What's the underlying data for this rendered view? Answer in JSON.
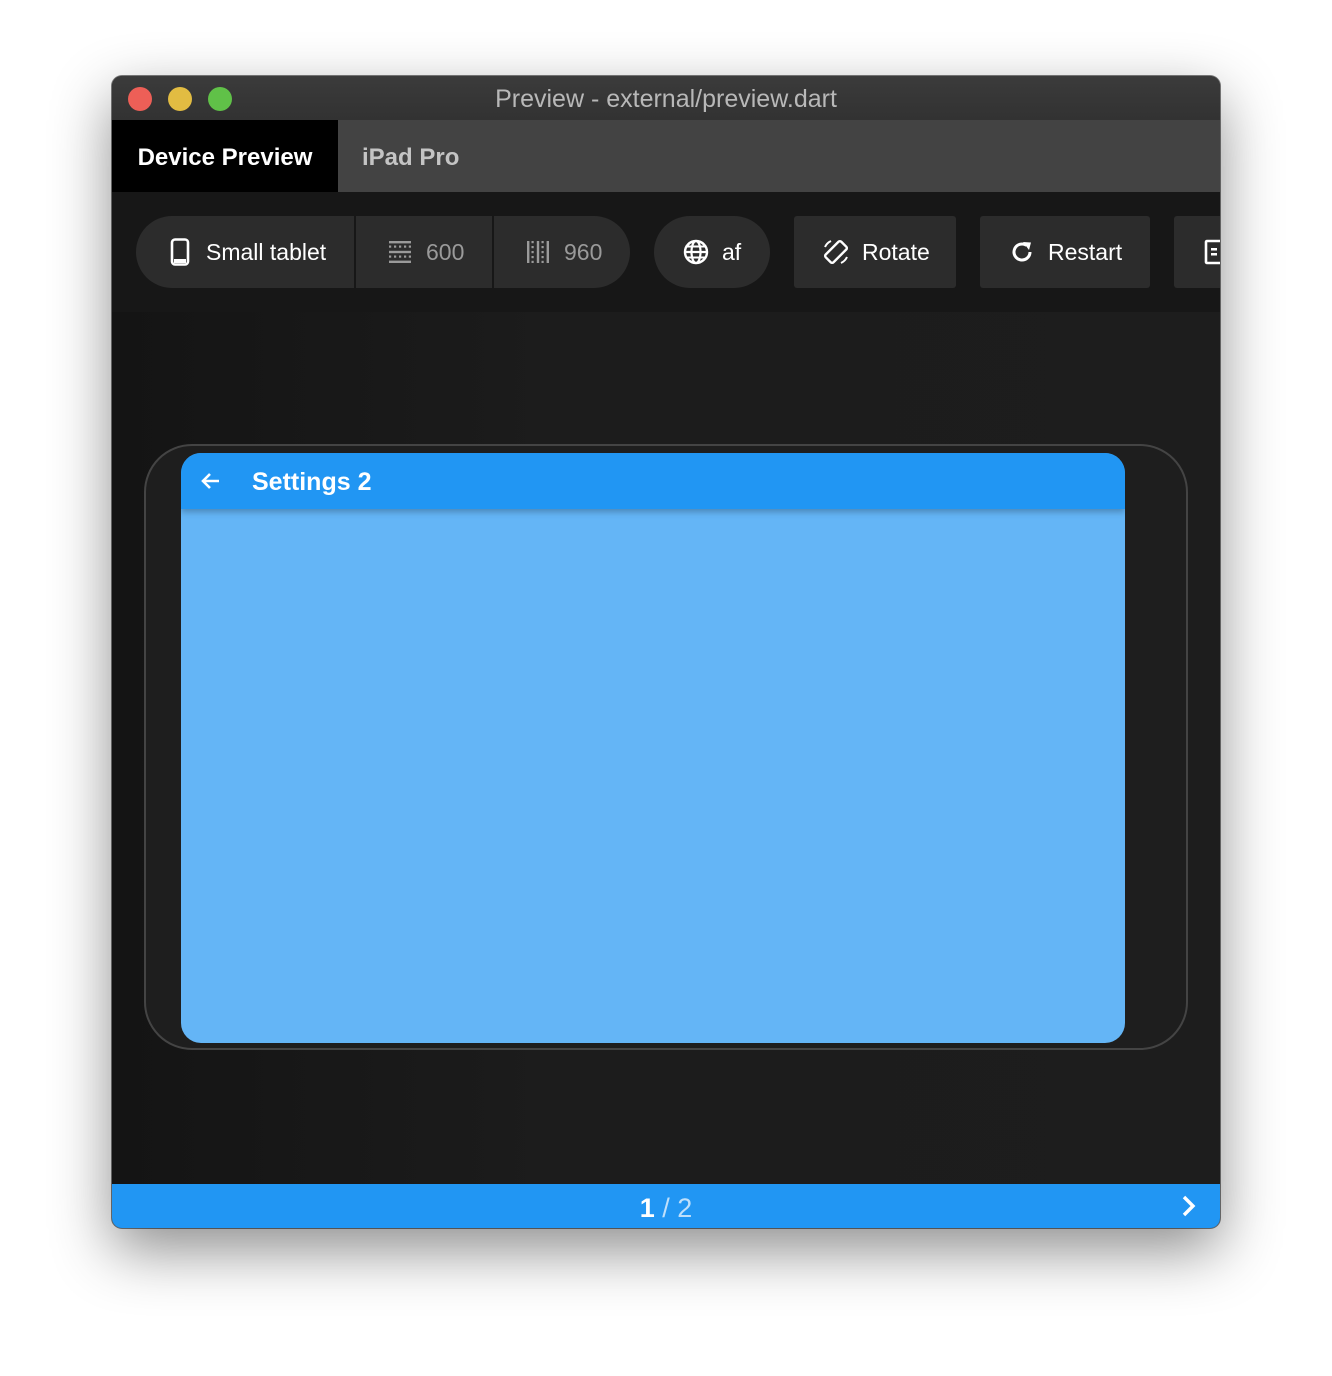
{
  "window": {
    "title": "Preview - external/preview.dart"
  },
  "tabs": [
    {
      "label": "Device Preview",
      "active": true
    },
    {
      "label": "iPad Pro",
      "active": false
    }
  ],
  "toolbar": {
    "device_label": "Small tablet",
    "width_value": "600",
    "height_value": "960",
    "locale_label": "af",
    "rotate_label": "Rotate",
    "restart_label": "Restart"
  },
  "app": {
    "title": "Settings 2",
    "appbar_color": "#2196f3",
    "body_color": "#64b5f6"
  },
  "pager": {
    "current": "1",
    "separator": " / ",
    "total": "2"
  },
  "icons": {
    "device": "phone-icon",
    "width": "width-grid-icon",
    "height": "height-grid-icon",
    "locale": "globe-icon",
    "rotate": "rotate-icon",
    "restart": "refresh-icon",
    "more": "screenshot-icon",
    "back": "arrow-back-icon",
    "next": "chevron-right-icon"
  }
}
